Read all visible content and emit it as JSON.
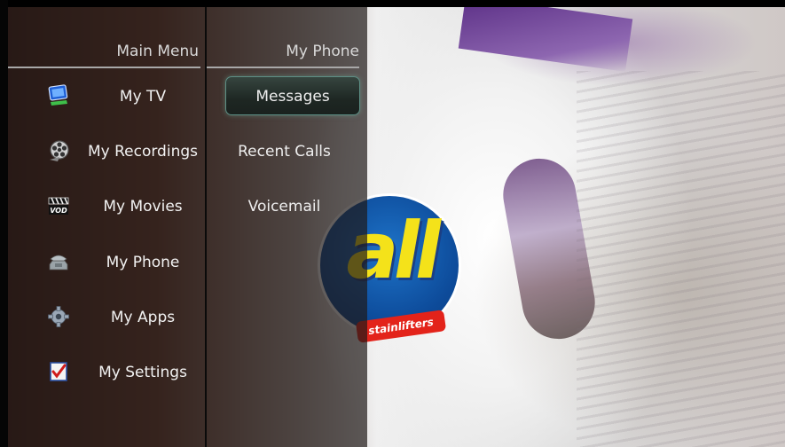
{
  "main_menu": {
    "title": "Main Menu",
    "items": [
      {
        "label": "My TV",
        "icon": "tv-icon"
      },
      {
        "label": "My Recordings",
        "icon": "film-reel-icon"
      },
      {
        "label": "My Movies",
        "icon": "vod-clapper-icon"
      },
      {
        "label": "My Phone",
        "icon": "phone-icon"
      },
      {
        "label": "My Apps",
        "icon": "gear-icon"
      },
      {
        "label": "My Settings",
        "icon": "checklist-icon"
      }
    ]
  },
  "phone_menu": {
    "title": "My Phone",
    "selected": "Messages",
    "items": [
      {
        "label": "Messages"
      },
      {
        "label": "Recent Calls"
      },
      {
        "label": "Voicemail"
      }
    ]
  },
  "background": {
    "logo_text": "all",
    "logo_tagline": "stainlifters",
    "logo_colors": {
      "ring": "#ffffff",
      "field": "#0d4b9a",
      "letters": "#f4e21a",
      "tagline_bg": "#e3231a"
    }
  },
  "colors": {
    "menu_text": "#f2f2f2",
    "header_text": "#d9d9d9",
    "selection_border": "#5d8f85"
  }
}
